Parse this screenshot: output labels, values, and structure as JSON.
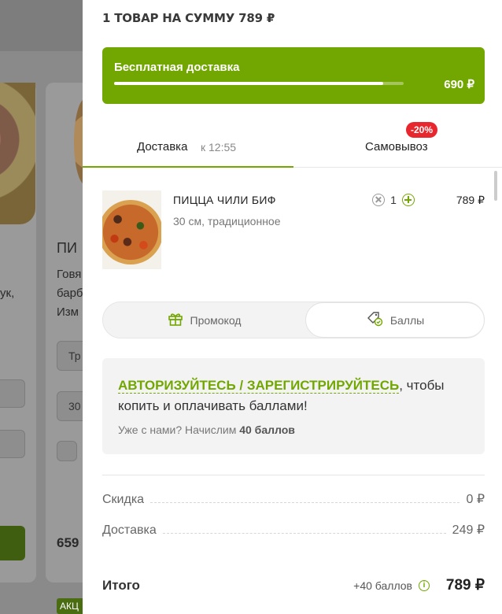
{
  "background": {
    "card_title_fragment": "ПИ",
    "desc_lines": [
      "Говя",
      "барб",
      "Изм"
    ],
    "left_text": "ук,",
    "select1": "Тр",
    "select2": "30",
    "price": "659",
    "badge": "АКЦ"
  },
  "cart": {
    "title": "1 ТОВАР НА СУММУ 789 ₽",
    "free_delivery": {
      "label": "Бесплатная доставка",
      "remaining": "690 ₽",
      "progress": 0.93
    },
    "tabs": {
      "delivery_label": "Доставка",
      "delivery_time": "к 12:55",
      "pickup_label": "Самовывоз",
      "pickup_discount": "-20%"
    },
    "item": {
      "name": "ПИЦЦА ЧИЛИ БИФ",
      "description": "30 см, традиционное",
      "quantity": "1",
      "price": "789 ₽"
    },
    "toggle": {
      "promo_label": "Промокод",
      "points_label": "Баллы"
    },
    "auth": {
      "link_text": "АВТОРИЗУЙТЕСЬ / ЗАРЕГИСТРИРУЙТЕСЬ",
      "rest_text": ", чтобы копить и оплачивать баллами!",
      "sub_text": "Уже с нами? Начислим ",
      "sub_bold": "40 баллов"
    },
    "summary": {
      "discount_label": "Скидка",
      "discount_value": "0 ₽",
      "delivery_label": "Доставка",
      "delivery_value": "249 ₽",
      "total_label": "Итого",
      "total_bonus": "+40 баллов",
      "total_value": "789 ₽"
    }
  },
  "colors": {
    "accent": "#72a701",
    "discount_badge": "#e8262d"
  }
}
